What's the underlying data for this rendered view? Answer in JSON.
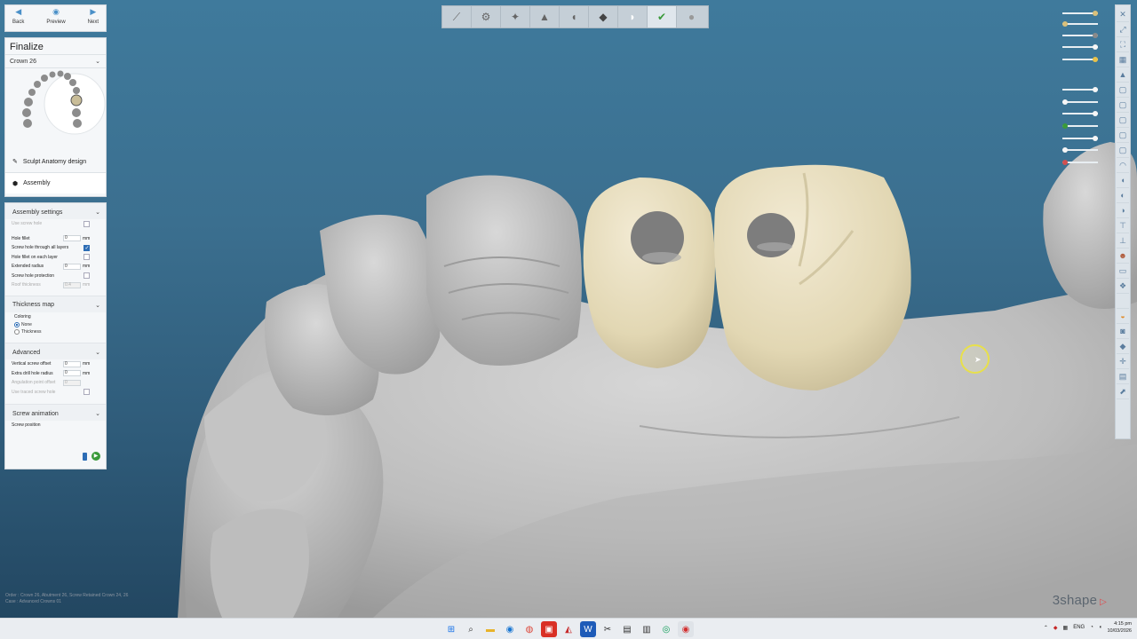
{
  "nav": {
    "back": "Back",
    "preview": "Preview",
    "next": "Next"
  },
  "panel": {
    "title": "Finalize",
    "selected": "Crown 26",
    "steps": [
      {
        "label": "Sculpt Anatomy design"
      },
      {
        "label": "Assembly"
      }
    ]
  },
  "assembly": {
    "header": "Assembly settings",
    "use_screw_hole": "Use screw hole",
    "hole_fillet": "Hole fillet",
    "hole_fillet_val": "0",
    "unit": "mm",
    "screw_through": "Screw hole through all layers",
    "fillet_each": "Hole fillet on each layer",
    "ext_radius": "Extended radius",
    "ext_radius_val": "0",
    "protection": "Screw hole protection",
    "roof": "Roof thickness",
    "roof_val": "0.4"
  },
  "thickness": {
    "header": "Thickness map",
    "coloring": "Coloring",
    "none": "None",
    "thickness": "Thickness"
  },
  "advanced": {
    "header": "Advanced",
    "vso": "Vertical screw offset",
    "vso_val": "0",
    "edr": "Extra drill hole radius",
    "edr_val": "0",
    "apo": "Angulation point offset",
    "apo_val": "0",
    "traced": "Use traced screw hole"
  },
  "screw_anim": {
    "header": "Screw animation",
    "position": "Screw position"
  },
  "toolbar_icons": [
    "scan-tool",
    "margin-tool",
    "insertion-tool",
    "abutment-tool",
    "tooth-tool",
    "anatomy-tool",
    "crown-tool",
    "finalize-tool",
    "close-tool"
  ],
  "status": {
    "line1": "Order : Crown 26, Abutment 26, Screw Retained Crown 24, 26",
    "line2": "Case : Advanced Crowns 01"
  },
  "brand": "3shape",
  "taskbar": {
    "lang": "ENG",
    "time": "4:15 pm",
    "date": "10/03/2026"
  }
}
